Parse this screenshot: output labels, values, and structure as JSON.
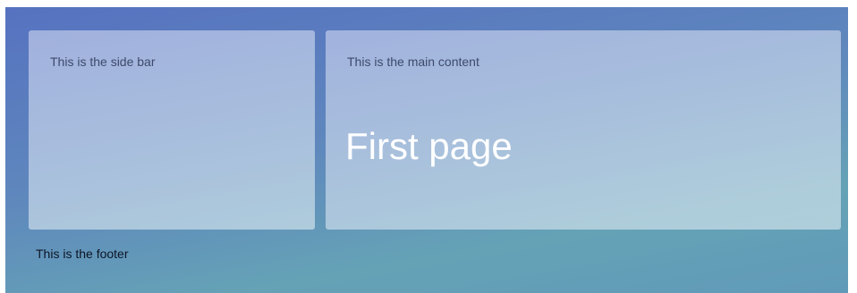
{
  "sidebar": {
    "text": "This is the side bar"
  },
  "main": {
    "text": "This is the main content",
    "heading": "First page"
  },
  "footer": {
    "text": "This is the footer"
  },
  "colors": {
    "background_top": "#5672c0",
    "background_bottom": "#65a2b6",
    "heading_text": "#ffffff"
  }
}
